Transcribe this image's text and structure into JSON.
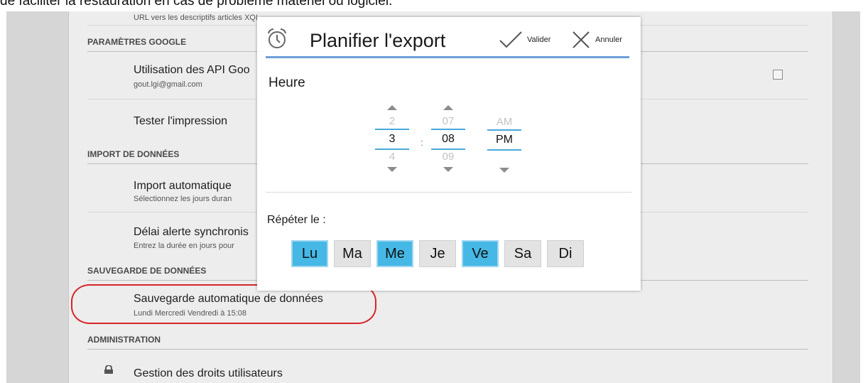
{
  "caption": "de faciliter la restauration en cas de problème matériel ou logiciel.",
  "settings": {
    "url_sub": "URL vers les descriptifs articles XQI",
    "sections": {
      "google": "PARAMÈTRES GOOGLE",
      "import": "IMPORT DE DONNÉES",
      "backup": "SAUVEGARDE DE DONNÉES",
      "admin": "ADMINISTRATION"
    },
    "api": {
      "title": "Utilisation des API Goo",
      "sub": "gout.lgi@gmail.com"
    },
    "print": {
      "title": "Tester l'impression"
    },
    "auto_import": {
      "title": "Import automatique",
      "sub": "Sélectionnez les jours duran"
    },
    "sync_delay": {
      "title": "Délai alerte synchronis",
      "sub": "Entrez la durée en jours pour"
    },
    "auto_backup": {
      "title": "Sauvegarde automatique de données",
      "sub": "Lundi  Mercredi  Vendredi à  15:08"
    },
    "rights": {
      "title": "Gestion des droits utilisateurs"
    }
  },
  "dialog": {
    "title": "Planifier l'export",
    "ok_label": "Valider",
    "cancel_label": "Annuler",
    "heure_label": "Heure",
    "picker": {
      "hour": {
        "prev": "2",
        "value": "3",
        "next": "4"
      },
      "minute": {
        "prev": "07",
        "value": "08",
        "next": "09"
      },
      "ampm": {
        "prev": "AM",
        "value": "PM"
      },
      "separator": ":"
    },
    "repeat_label": "Répéter le :",
    "days": [
      {
        "label": "Lu",
        "selected": true
      },
      {
        "label": "Ma",
        "selected": false
      },
      {
        "label": "Me",
        "selected": true
      },
      {
        "label": "Je",
        "selected": false
      },
      {
        "label": "Ve",
        "selected": true
      },
      {
        "label": "Sa",
        "selected": false
      },
      {
        "label": "Di",
        "selected": false
      }
    ]
  },
  "colors": {
    "accent": "#45b8e6",
    "title_line": "#6d9fd8",
    "highlight": "#d62626"
  },
  "icons": [
    "alarm-clock-icon",
    "checkmark-icon",
    "close-icon",
    "lock-icon",
    "checkbox-icon"
  ]
}
